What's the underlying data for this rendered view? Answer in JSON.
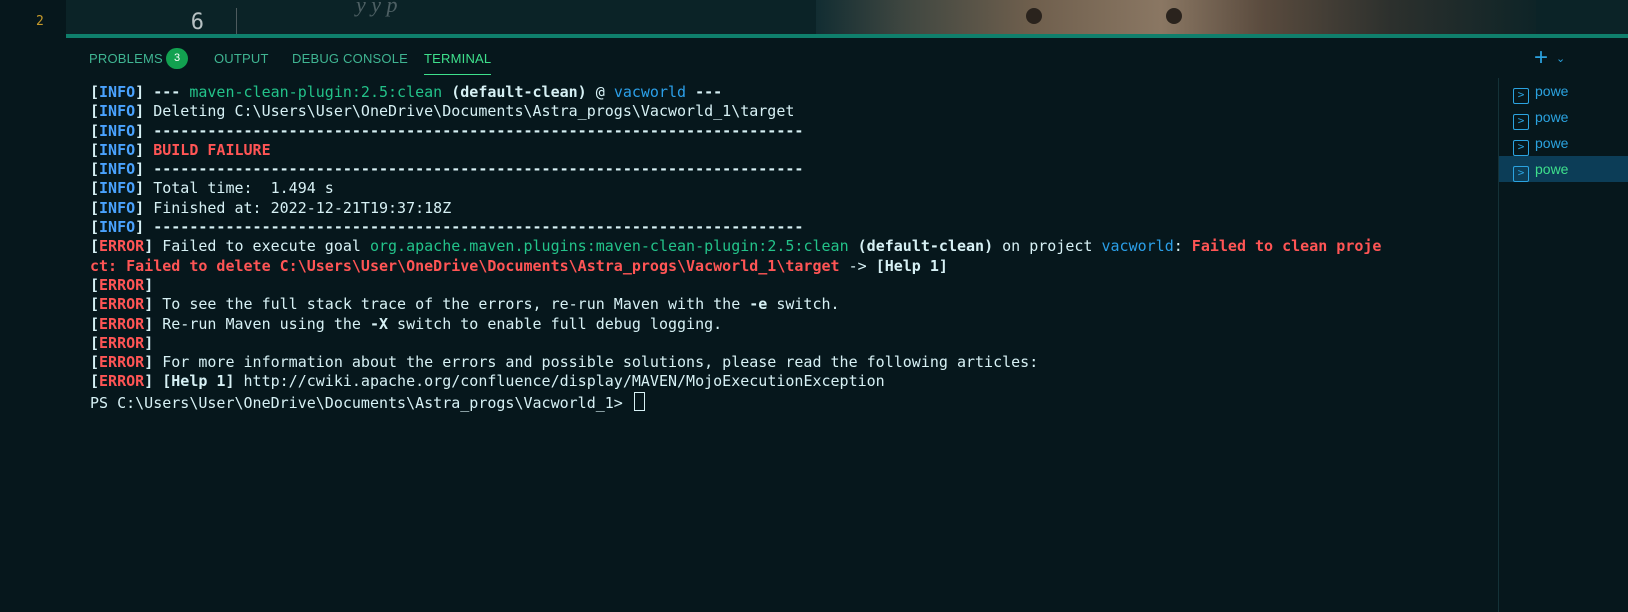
{
  "editor": {
    "activity_line_number": "2",
    "gutter_line_number": "6",
    "ghost_text": "y  y  p"
  },
  "panel": {
    "tabs": [
      {
        "label": "PROBLEMS",
        "badge": "3"
      },
      {
        "label": "OUTPUT"
      },
      {
        "label": "DEBUG CONSOLE"
      },
      {
        "label": "TERMINAL",
        "active": true
      }
    ],
    "new_terminal_icon": "plus-icon",
    "new_terminal_chevron_icon": "chevron-down-icon"
  },
  "terminal": {
    "lines": [
      [
        {
          "t": "[",
          "c": "c-br"
        },
        {
          "t": "INFO",
          "c": "c-info"
        },
        {
          "t": "] ",
          "c": "c-br"
        },
        {
          "t": "--- ",
          "c": "c-bold"
        },
        {
          "t": "maven-clean-plugin:2.5:clean",
          "c": "c-green"
        },
        {
          "t": " (default-clean)",
          "c": "c-bold"
        },
        {
          "t": " @ ",
          "c": "c-plain"
        },
        {
          "t": "vacworld",
          "c": "c-blue"
        },
        {
          "t": " ---",
          "c": "c-bold"
        }
      ],
      [
        {
          "t": "[",
          "c": "c-br"
        },
        {
          "t": "INFO",
          "c": "c-info"
        },
        {
          "t": "] ",
          "c": "c-br"
        },
        {
          "t": "Deleting C:\\Users\\User\\OneDrive\\Documents\\Astra_progs\\Vacworld_1\\target",
          "c": "c-plain"
        }
      ],
      [
        {
          "t": "[",
          "c": "c-br"
        },
        {
          "t": "INFO",
          "c": "c-info"
        },
        {
          "t": "] ",
          "c": "c-br"
        },
        {
          "t": "------------------------------------------------------------------------",
          "c": "c-bold"
        }
      ],
      [
        {
          "t": "[",
          "c": "c-br"
        },
        {
          "t": "INFO",
          "c": "c-info"
        },
        {
          "t": "] ",
          "c": "c-br"
        },
        {
          "t": "BUILD FAILURE",
          "c": "c-errtxt"
        }
      ],
      [
        {
          "t": "[",
          "c": "c-br"
        },
        {
          "t": "INFO",
          "c": "c-info"
        },
        {
          "t": "] ",
          "c": "c-br"
        },
        {
          "t": "------------------------------------------------------------------------",
          "c": "c-bold"
        }
      ],
      [
        {
          "t": "[",
          "c": "c-br"
        },
        {
          "t": "INFO",
          "c": "c-info"
        },
        {
          "t": "] ",
          "c": "c-br"
        },
        {
          "t": "Total time:  1.494 s",
          "c": "c-plain"
        }
      ],
      [
        {
          "t": "[",
          "c": "c-br"
        },
        {
          "t": "INFO",
          "c": "c-info"
        },
        {
          "t": "] ",
          "c": "c-br"
        },
        {
          "t": "Finished at: 2022-12-21T19:37:18Z",
          "c": "c-plain"
        }
      ],
      [
        {
          "t": "[",
          "c": "c-br"
        },
        {
          "t": "INFO",
          "c": "c-info"
        },
        {
          "t": "] ",
          "c": "c-br"
        },
        {
          "t": "------------------------------------------------------------------------",
          "c": "c-bold"
        }
      ],
      [
        {
          "t": "[",
          "c": "c-br"
        },
        {
          "t": "ERROR",
          "c": "c-err"
        },
        {
          "t": "] ",
          "c": "c-br"
        },
        {
          "t": "Failed to execute goal ",
          "c": "c-plain"
        },
        {
          "t": "org.apache.maven.plugins:maven-clean-plugin:2.5:clean",
          "c": "c-green"
        },
        {
          "t": " (default-clean)",
          "c": "c-bold"
        },
        {
          "t": " on project ",
          "c": "c-plain"
        },
        {
          "t": "vacworld",
          "c": "c-blue"
        },
        {
          "t": ": ",
          "c": "c-plain"
        },
        {
          "t": "Failed to clean proje",
          "c": "c-errtxt"
        }
      ],
      [
        {
          "t": "ct: Failed to delete C:\\Users\\User\\OneDrive\\Documents\\Astra_progs\\Vacworld_1\\target",
          "c": "c-errtxt"
        },
        {
          "t": " -> ",
          "c": "c-plain"
        },
        {
          "t": "[Help 1]",
          "c": "c-bold"
        }
      ],
      [
        {
          "t": "[",
          "c": "c-br"
        },
        {
          "t": "ERROR",
          "c": "c-err"
        },
        {
          "t": "]",
          "c": "c-br"
        }
      ],
      [
        {
          "t": "[",
          "c": "c-br"
        },
        {
          "t": "ERROR",
          "c": "c-err"
        },
        {
          "t": "] ",
          "c": "c-br"
        },
        {
          "t": "To see the full stack trace of the errors, re-run Maven with the ",
          "c": "c-plain"
        },
        {
          "t": "-e",
          "c": "c-bold"
        },
        {
          "t": " switch.",
          "c": "c-plain"
        }
      ],
      [
        {
          "t": "[",
          "c": "c-br"
        },
        {
          "t": "ERROR",
          "c": "c-err"
        },
        {
          "t": "] ",
          "c": "c-br"
        },
        {
          "t": "Re-run Maven using the ",
          "c": "c-plain"
        },
        {
          "t": "-X",
          "c": "c-bold"
        },
        {
          "t": " switch to enable full debug logging.",
          "c": "c-plain"
        }
      ],
      [
        {
          "t": "[",
          "c": "c-br"
        },
        {
          "t": "ERROR",
          "c": "c-err"
        },
        {
          "t": "]",
          "c": "c-br"
        }
      ],
      [
        {
          "t": "[",
          "c": "c-br"
        },
        {
          "t": "ERROR",
          "c": "c-err"
        },
        {
          "t": "] ",
          "c": "c-br"
        },
        {
          "t": "For more information about the errors and possible solutions, please read the following articles:",
          "c": "c-plain"
        }
      ],
      [
        {
          "t": "[",
          "c": "c-br"
        },
        {
          "t": "ERROR",
          "c": "c-err"
        },
        {
          "t": "] ",
          "c": "c-br"
        },
        {
          "t": "[Help 1]",
          "c": "c-bold"
        },
        {
          "t": " http://cwiki.apache.org/confluence/display/MAVEN/MojoExecutionException",
          "c": "c-plain"
        }
      ],
      [
        {
          "t": "PS C:\\Users\\User\\OneDrive\\Documents\\Astra_progs\\Vacworld_1> ",
          "c": "c-plain"
        }
      ]
    ]
  },
  "terminal_list": {
    "items": [
      {
        "label": "powe",
        "icon": "terminal-icon"
      },
      {
        "label": "powe",
        "icon": "terminal-icon"
      },
      {
        "label": "powe",
        "icon": "terminal-icon"
      },
      {
        "label": "powe",
        "icon": "terminal-icon",
        "active": true
      }
    ]
  }
}
